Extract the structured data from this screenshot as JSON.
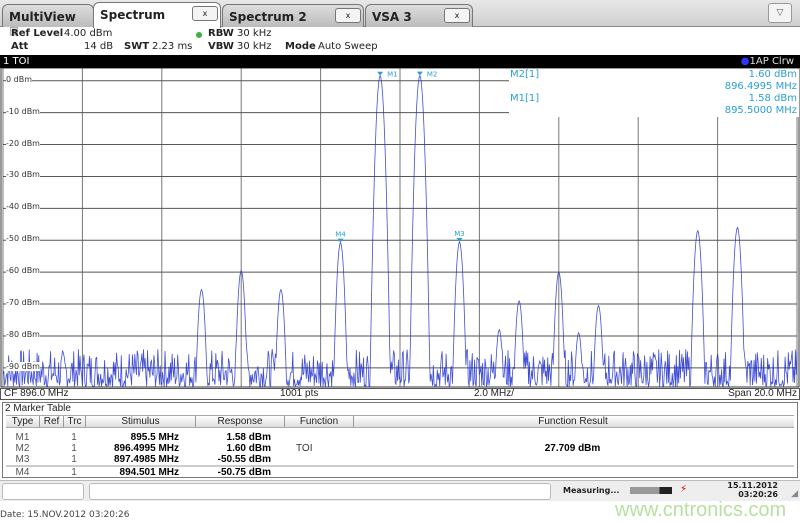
{
  "tabs": [
    {
      "label": "MultiView",
      "active": false
    },
    {
      "label": "Spectrum",
      "active": true,
      "close": "x"
    },
    {
      "label": "Spectrum 2",
      "active": false,
      "close": "x"
    },
    {
      "label": "VSA 3",
      "active": false,
      "close": "x"
    }
  ],
  "dropdown_icon": "chevron-down-icon",
  "settings": {
    "ref_level_label": "Ref Level",
    "ref_level": "4.00 dBm",
    "att_label": "Att",
    "att": "14 dB",
    "swt_label": "SWT",
    "swt": "2.23 ms",
    "rbw_label": "RBW",
    "rbw": "30 kHz",
    "vbw_label": "VBW",
    "vbw": "30 kHz",
    "mode_label": "Mode",
    "mode": "Auto Sweep",
    "rbw_indicator_color": "#3cb043"
  },
  "window": {
    "title": "1 TOI",
    "trace_label": "1AP Clrw"
  },
  "marker_info": {
    "m2_label": "M2[1]",
    "m2_level": "1.60 dBm",
    "m2_freq": "896.4995 MHz",
    "m1_label": "M1[1]",
    "m1_level": "1.58 dBm",
    "m1_freq": "895.5000 MHz"
  },
  "chart_data": {
    "type": "line",
    "xlabel": "",
    "ylabel": "",
    "x_unit": "MHz",
    "xlim": [
      886.0,
      906.0
    ],
    "ylim": [
      -96,
      4
    ],
    "y_ticks": [
      "0 dBm",
      "-10 dBm",
      "-20 dBm",
      "-30 dBm",
      "-40 dBm",
      "-50 dBm",
      "-60 dBm",
      "-70 dBm",
      "-80 dBm",
      "-90 dBm"
    ],
    "y_tick_values": [
      0,
      -10,
      -20,
      -30,
      -40,
      -50,
      -60,
      -70,
      -80,
      -90
    ],
    "grid": true,
    "noise_floor_dbm": [
      -96,
      -84
    ],
    "trace_color": "#2030d0",
    "peaks": [
      {
        "x": 891.0,
        "y": -65.5
      },
      {
        "x": 892.0,
        "y": -59.5
      },
      {
        "x": 893.0,
        "y": -65.5
      },
      {
        "x": 894.501,
        "y": -50.75,
        "marker": "M4"
      },
      {
        "x": 895.5,
        "y": 1.58,
        "marker": "M1"
      },
      {
        "x": 896.4995,
        "y": 1.6,
        "marker": "M2"
      },
      {
        "x": 897.4985,
        "y": -50.55,
        "marker": "M3"
      },
      {
        "x": 898.5,
        "y": -78
      },
      {
        "x": 899.0,
        "y": -69
      },
      {
        "x": 900.0,
        "y": -60
      },
      {
        "x": 900.5,
        "y": -79
      },
      {
        "x": 901.0,
        "y": -70.5
      },
      {
        "x": 903.5,
        "y": -47
      },
      {
        "x": 904.5,
        "y": -46
      }
    ]
  },
  "axis": {
    "cf": "CF 896.0 MHz",
    "pts": "1001 pts",
    "div": "2.0 MHz/",
    "span": "Span 20.0 MHz"
  },
  "marker_table": {
    "title": "2 Marker Table",
    "headers": [
      "Type",
      "Ref",
      "Trc",
      "Stimulus",
      "Response",
      "Function",
      "Function Result"
    ],
    "rows": [
      {
        "type": "M1",
        "ref": "",
        "trc": "1",
        "stimulus": "895.5 MHz",
        "response": "1.58 dBm",
        "function": "",
        "result": ""
      },
      {
        "type": "M2",
        "ref": "",
        "trc": "1",
        "stimulus": "896.4995 MHz",
        "response": "1.60 dBm",
        "function": "TOI",
        "result": "27.709 dBm"
      },
      {
        "type": "M3",
        "ref": "",
        "trc": "1",
        "stimulus": "897.4985 MHz",
        "response": "-50.55 dBm",
        "function": "",
        "result": ""
      },
      {
        "type": "M4",
        "ref": "",
        "trc": "1",
        "stimulus": "894.501 MHz",
        "response": "-50.75 dBm",
        "function": "",
        "result": ""
      }
    ]
  },
  "status": {
    "measuring": "Measuring...",
    "date": "15.11.2012",
    "time": "03:20:26"
  },
  "footer": {
    "date": "Date: 15.NOV.2012  03:20:26",
    "watermark": "www.cntronics.com"
  }
}
